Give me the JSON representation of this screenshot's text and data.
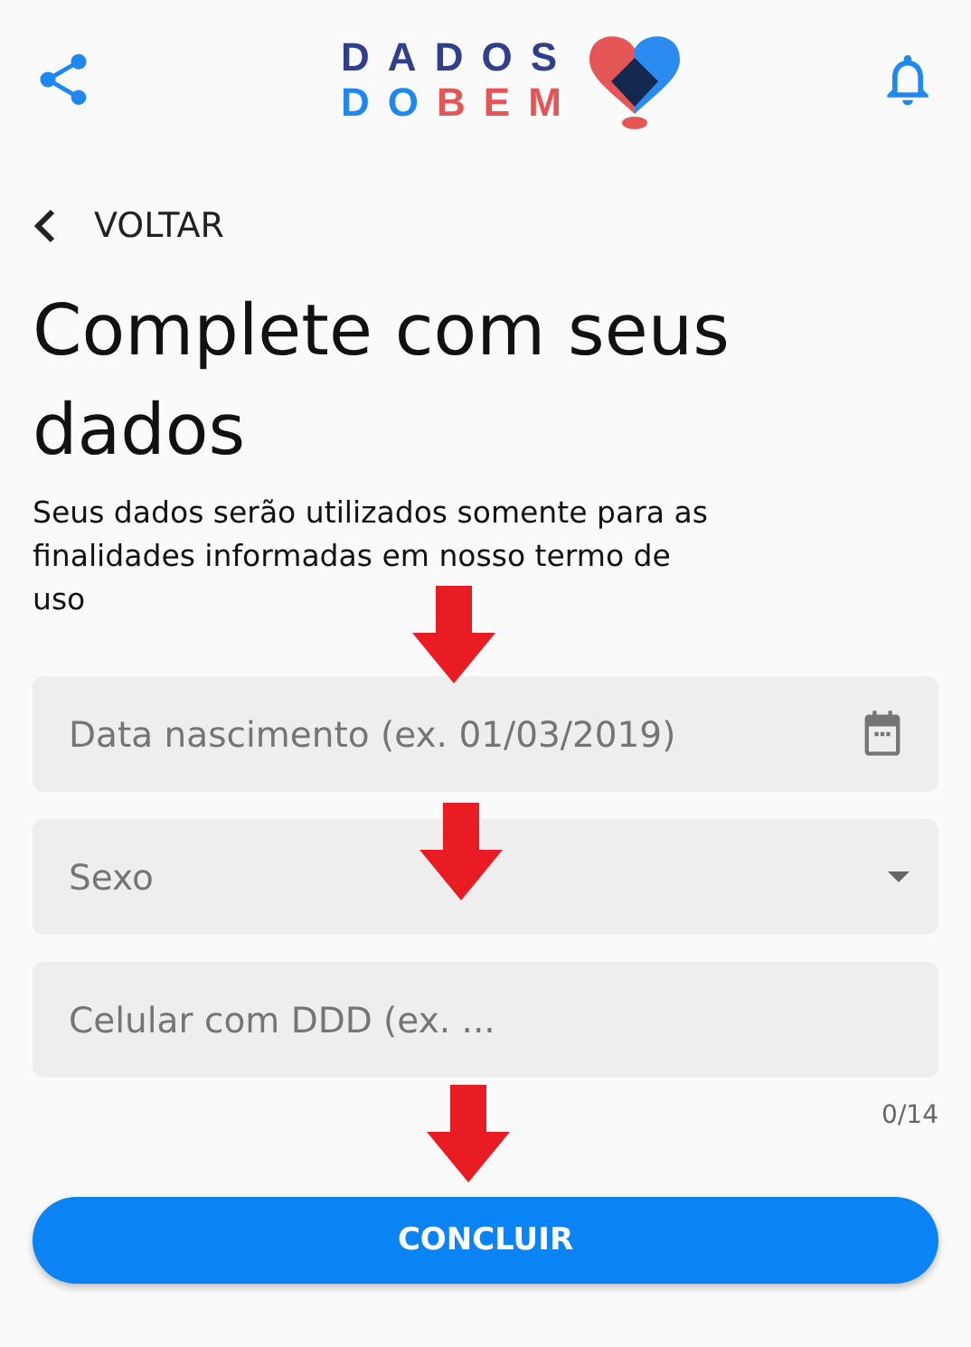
{
  "header": {
    "logo": [
      [
        {
          "text": "DADOS",
          "color": "#2f3f8a"
        }
      ],
      [
        {
          "text": "DO",
          "color": "#1e88f0"
        },
        {
          "text": "BEM",
          "color": "#e45555"
        }
      ]
    ]
  },
  "back": {
    "label": "VOLTAR"
  },
  "title": "Complete com seus dados",
  "subtitle": "Seus dados serão utilizados somente para as finalidades informadas em nosso termo de uso",
  "fields": [
    {
      "kind": "date",
      "placeholder": "Data nascimento (ex. 01/03/2019)"
    },
    {
      "kind": "select",
      "placeholder": "Sexo"
    },
    {
      "kind": "text",
      "placeholder": "Celular com DDD (ex. ...",
      "counter": "0/14"
    }
  ],
  "submit": {
    "label": "CONCLUIR"
  }
}
